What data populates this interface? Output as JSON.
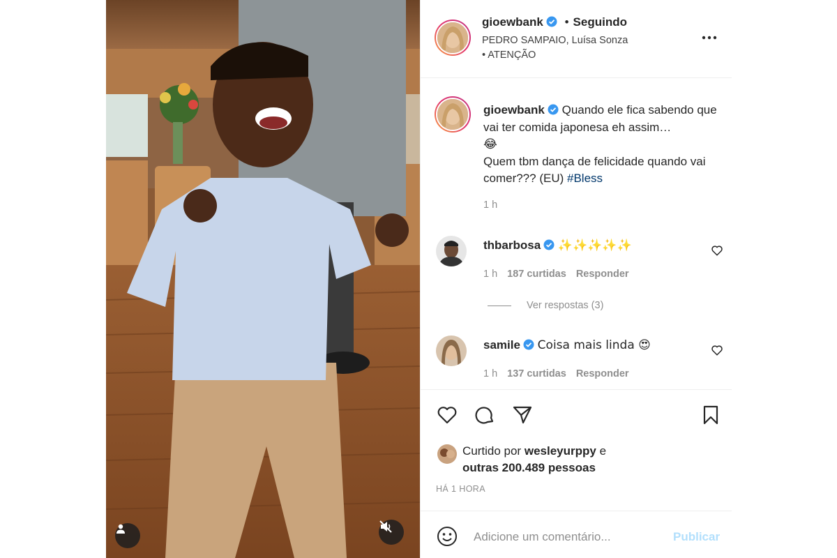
{
  "post": {
    "username": "gioewbank",
    "separator": "•",
    "follow_status": "Seguindo",
    "audio": "PEDRO SAMPAIO, Luísa Sonza • ATENÇÃO",
    "caption_user": "gioewbank",
    "caption_line1": "Quando ele fica sabendo que vai ter comida japonesa eh assim…",
    "caption_emoji": "😂",
    "caption_line2": "Quem tbm dança de felicidade quando vai comer??? (EU)",
    "caption_hashtag": "#Bless",
    "caption_time": "1 h"
  },
  "comments": [
    {
      "username": "thbarbosa",
      "text": "✨✨✨✨✨",
      "time": "1 h",
      "likes": "187 curtidas",
      "reply": "Responder"
    },
    {
      "username": "samile",
      "text": "Coisa mais linda 😍",
      "time": "1 h",
      "likes": "137 curtidas",
      "reply": "Responder"
    }
  ],
  "replies_toggle": "Ver respostas (3)",
  "likes": {
    "prefix": "Curtido por",
    "user": "wesleyurppy",
    "conjunction": "e",
    "others": "outras 200.489 pessoas"
  },
  "post_time": "HÁ 1 HORA",
  "add_comment": {
    "placeholder": "Adicione um comentário...",
    "publish": "Publicar"
  },
  "colors": {
    "verified": "#3897f0",
    "link": "#00376b",
    "publish_disabled": "#b2dffc",
    "secondary_text": "#8e8e8e"
  },
  "icons": {
    "media": [
      "user-tag-icon",
      "mute-icon"
    ],
    "actions": [
      "heart-icon",
      "comment-icon",
      "share-icon",
      "bookmark-icon"
    ],
    "header": [
      "more-icon",
      "verified-icon"
    ],
    "composer": [
      "emoji-icon"
    ]
  }
}
